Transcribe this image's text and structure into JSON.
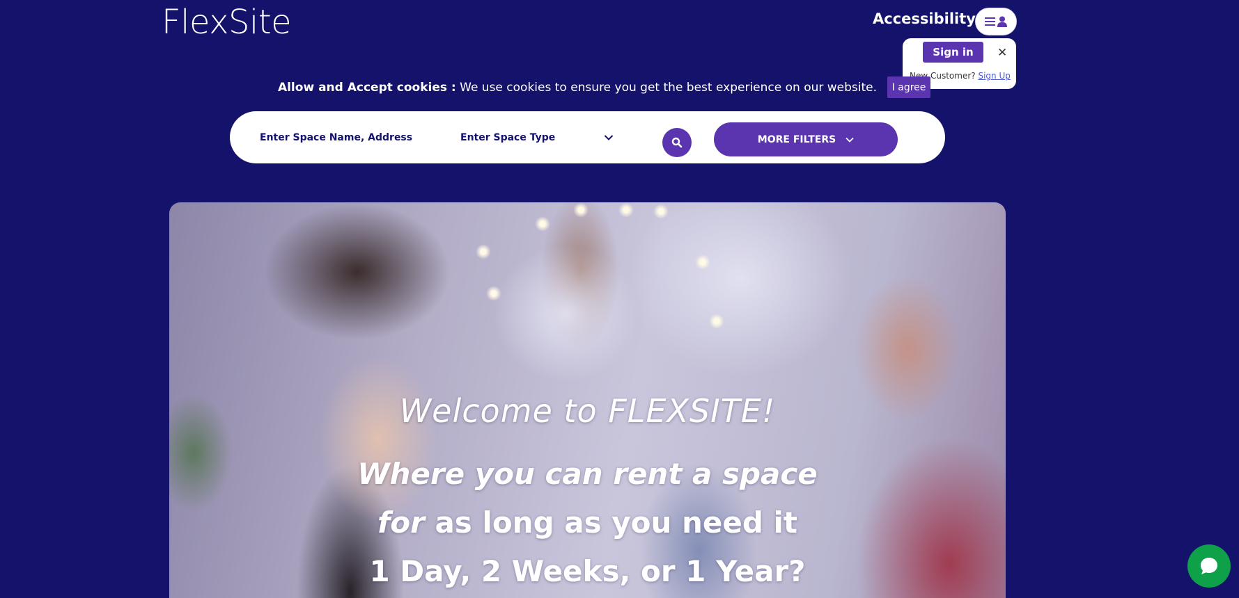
{
  "header": {
    "logo": "FlexSite",
    "accessibility_label": "Accessibility",
    "menu_icon": "hamburger-user-icon"
  },
  "account_popover": {
    "signin_label": "Sign in",
    "close_glyph": "✕",
    "new_customer_text": "New Customer?",
    "signup_label": "Sign Up"
  },
  "cookie_bar": {
    "bold_text": "Allow and Accept cookies :",
    "message": "We use cookies to ensure you get the best experience on our website.",
    "agree_label": "I agree"
  },
  "search": {
    "name_placeholder": "Enter Space Name, Address",
    "type_label": "Enter Space Type",
    "more_filters_label": "MORE FILTERS"
  },
  "hero": {
    "welcome": "Welcome to FLEXSITE!",
    "line1": "Where you can rent a space",
    "line2_italic": "for",
    "line2_rest": "as long as you need it",
    "line3": "1 Day, 2 Weeks, or 1 Year?"
  },
  "colors": {
    "background": "#14126b",
    "accent": "#5b35b0",
    "chat": "#0fa04a"
  }
}
